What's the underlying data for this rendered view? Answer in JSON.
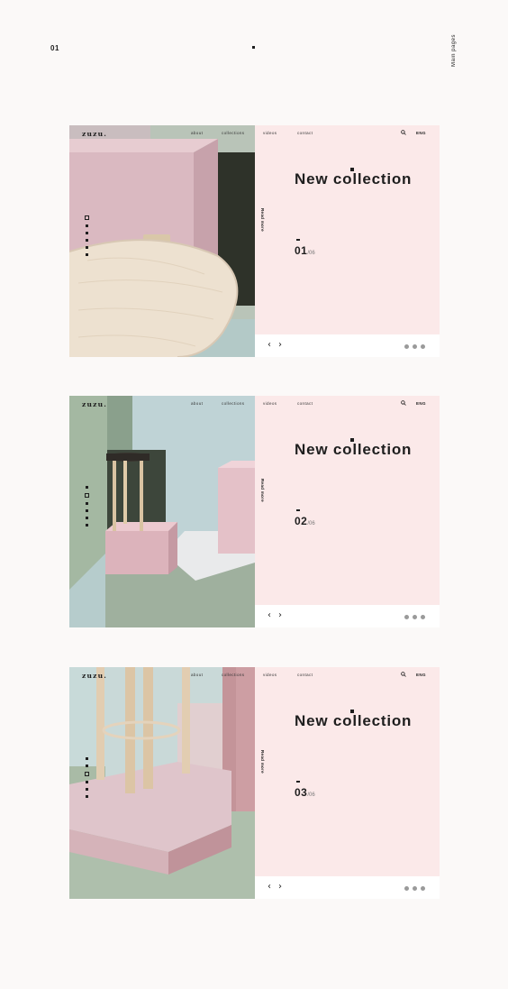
{
  "page": {
    "number": "01",
    "side_label": "Main pages"
  },
  "nav": {
    "logo": "zuzu.",
    "about": "about",
    "collections": "collections",
    "videos": "videos",
    "contact": "contact",
    "lang": "ENG"
  },
  "hero": {
    "read_more": "Read more",
    "title": "New collection",
    "total": "/06",
    "prev_arrow": "‹",
    "next_arrow": "›"
  },
  "slides": [
    {
      "current": "01"
    },
    {
      "current": "02"
    },
    {
      "current": "03"
    }
  ],
  "colors": {
    "panel_pink": "#fbe9e9",
    "mauve": "#dbb9c2",
    "sage": "#9fb29f",
    "light_blue": "#bcd3d6",
    "dark": "#1e1e1e"
  }
}
